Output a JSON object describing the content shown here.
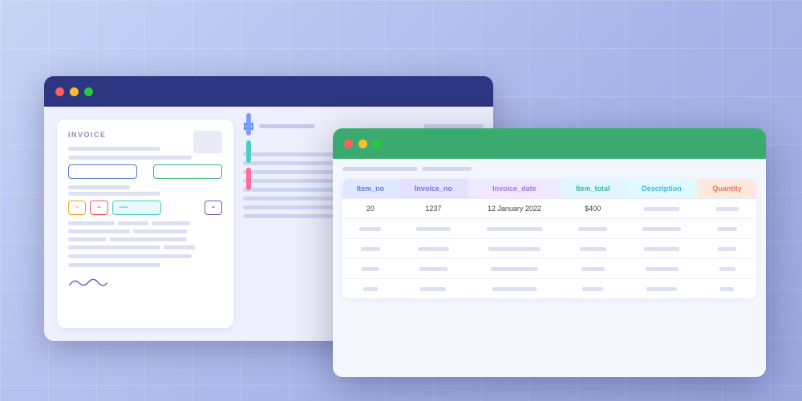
{
  "background": {
    "color_start": "#c8d4f5",
    "color_end": "#9ba8e0"
  },
  "window_back": {
    "titlebar_color": "#2d3680",
    "dots": [
      "#ff6058",
      "#ffbd2e",
      "#28c840"
    ],
    "logo_symbol": "⋈",
    "lines": [
      "60%",
      "80%",
      "45%",
      "70%",
      "55%"
    ]
  },
  "invoice": {
    "title": "INVOICE",
    "fields": [
      {
        "type": "blue-border"
      },
      {
        "type": "green-border"
      }
    ],
    "buttons": [
      {
        "label": "orange",
        "color": "orange"
      },
      {
        "label": "red",
        "color": "red"
      },
      {
        "label": "teal",
        "color": "teal"
      },
      {
        "label": "purple",
        "color": "purple"
      }
    ],
    "signature": "~~~"
  },
  "sidebar_bars": [
    {
      "color": "#7c9ef8"
    },
    {
      "color": "#4ecdc4"
    },
    {
      "color": "#ff6b9d"
    }
  ],
  "window_front": {
    "titlebar_color": "#3aaa6f",
    "dots": [
      "#ff6058",
      "#ffbd2e",
      "#28c840"
    ]
  },
  "table": {
    "headers": [
      {
        "label": "Item_no",
        "class": "th-blue"
      },
      {
        "label": "Invoice_no",
        "class": "th-indigo"
      },
      {
        "label": "Invoice_date",
        "class": "th-purple"
      },
      {
        "label": "Item_total",
        "class": "th-green"
      },
      {
        "label": "Description",
        "class": "th-teal"
      },
      {
        "label": "Quantity",
        "class": "th-pink"
      }
    ],
    "rows": [
      {
        "item_no": "20",
        "invoice_no": "1237",
        "invoice_date": "12 January 2022",
        "item_total": "$400",
        "description": "",
        "quantity": ""
      },
      {
        "item_no": "",
        "invoice_no": "",
        "invoice_date": "",
        "item_total": "",
        "description": "",
        "quantity": ""
      },
      {
        "item_no": "",
        "invoice_no": "",
        "invoice_date": "",
        "item_total": "",
        "description": "",
        "quantity": ""
      },
      {
        "item_no": "",
        "invoice_no": "",
        "invoice_date": "",
        "item_total": "",
        "description": "",
        "quantity": ""
      }
    ]
  }
}
